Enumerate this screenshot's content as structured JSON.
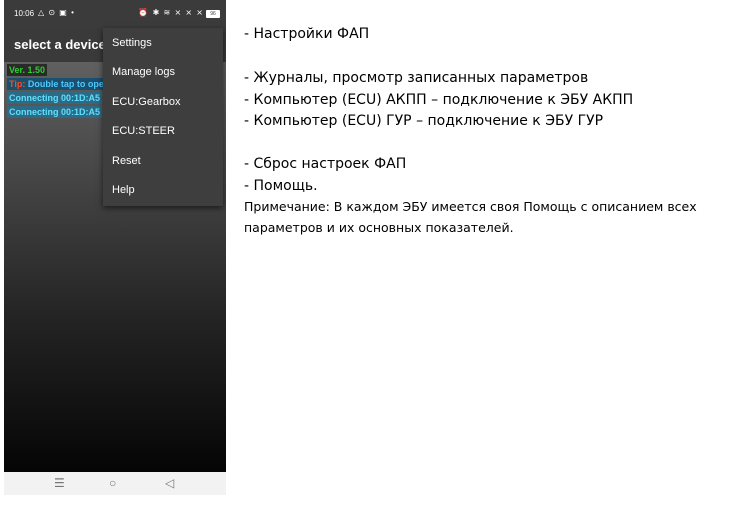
{
  "status_bar": {
    "time": "10:06",
    "left_icons": "△ ⊙ ▣ •",
    "right_icons": "⏰ ✱ ≋ ⨯ ⨯ ⨯",
    "battery": "96"
  },
  "app_bar": {
    "title": "select a device t"
  },
  "log": {
    "version": "Ver. 1.50",
    "tip_prefix": "Tip:",
    "tip_body": " Double tap to ope",
    "connecting_1": "Connecting 00:1D:A5",
    "connecting_2": "Connecting 00:1D:A5"
  },
  "menu": {
    "items": [
      {
        "label": "Settings"
      },
      {
        "label": "Manage logs"
      },
      {
        "label": "ECU:Gearbox"
      },
      {
        "label": "ECU:STEER"
      },
      {
        "label": "Reset"
      },
      {
        "label": "Help"
      }
    ]
  },
  "nav": {
    "recents": "☰",
    "home": "○",
    "back": "◁"
  },
  "annotations": {
    "settings": "- Настройки ФАП",
    "logs": "- Журналы, просмотр записанных параметров",
    "gearbox": "- Компьютер (ECU) АКПП – подключение к ЭБУ АКПП",
    "steer": "- Компьютер (ECU) ГУР – подключение к ЭБУ ГУР",
    "reset": "- Сброс настроек ФАП",
    "help": "- Помощь.",
    "note": "Примечание: В каждом ЭБУ имеется своя Помощь с описанием всех параметров и их основных показателей."
  },
  "colors": {
    "version_green": "#33cc33",
    "tip_orange": "#ff4b1f",
    "tip_blue": "#4fc8ff",
    "connecting_cyan": "#5ee0ff",
    "menu_bg": "#3e3e3e"
  }
}
